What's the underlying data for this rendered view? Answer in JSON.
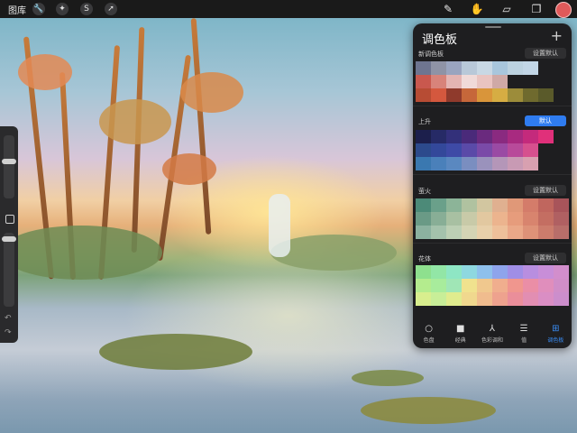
{
  "topbar": {
    "gallery_label": "图库",
    "left_tools": [
      {
        "name": "wrench-icon",
        "glyph": "🔧"
      },
      {
        "name": "magic-wand-icon",
        "glyph": "✦"
      },
      {
        "name": "selection-s-icon",
        "glyph": "S"
      },
      {
        "name": "transform-arrow-icon",
        "glyph": "➚"
      }
    ],
    "right_tools": [
      {
        "name": "brush-icon",
        "glyph": "✎"
      },
      {
        "name": "smudge-icon",
        "glyph": "✋"
      },
      {
        "name": "eraser-icon",
        "glyph": "▱"
      },
      {
        "name": "layers-icon",
        "glyph": "❐"
      }
    ],
    "color_swatch": "#e05a5a"
  },
  "panel": {
    "title": "调色板",
    "add_glyph": "+",
    "sections": [
      {
        "name": "新调色板",
        "button": "设置默认",
        "active": false,
        "rows": [
          [
            "#6e7590",
            "#8f93a6",
            "#9aa4bf",
            "#b8c8d8",
            "#c8d8e4",
            "#a8c6dc",
            "#bcd2e0",
            "#c2d6e6",
            "#1e1e20",
            "#1e1e20"
          ],
          [
            "#c9584e",
            "#d8837a",
            "#e4b4b2",
            "#f0dad8",
            "#e9c4c0",
            "#cfa9a6",
            "#1e1e20",
            "#1e1e20",
            "#1e1e20",
            "#1e1e20"
          ],
          [
            "#b74c34",
            "#d4583e",
            "#8f3a2c",
            "#c6673a",
            "#d9953a",
            "#d6ad43",
            "#9c8c3a",
            "#6f6a2e",
            "#5a5a2a",
            "#1e1e20"
          ]
        ]
      },
      {
        "name": "上升",
        "button": "默认",
        "active": true,
        "rows": [
          [
            "#1c1f4c",
            "#262a66",
            "#33307a",
            "#4a2a7a",
            "#6a2a7e",
            "#8a2a80",
            "#a82a80",
            "#c42a7c",
            "#e0307a",
            "#1e1e20"
          ],
          [
            "#2c4a8c",
            "#33489a",
            "#3e4aa6",
            "#5a4aa8",
            "#7a4aa8",
            "#9a4aa4",
            "#b84a9a",
            "#d6508e",
            "#1e1e20",
            "#1e1e20"
          ],
          [
            "#3a78b0",
            "#4a80ba",
            "#5a88c0",
            "#7a8ec0",
            "#9a92bc",
            "#b496b8",
            "#c89ab4",
            "#d8a0b0",
            "#1e1e20",
            "#1e1e20"
          ]
        ]
      },
      {
        "name": "萤火",
        "button": "设置默认",
        "active": false,
        "rows": [
          [
            "#4c8a78",
            "#6aa08a",
            "#8cb498",
            "#b0c2a0",
            "#d2c6a0",
            "#e0b090",
            "#e09878",
            "#d47c6a",
            "#c0665e",
            "#a8545a"
          ],
          [
            "#6a9a86",
            "#88ae96",
            "#a8c0a2",
            "#c8caa8",
            "#e2c8a0",
            "#ecb48e",
            "#e69c7c",
            "#d8846e",
            "#c46e62",
            "#b06062"
          ],
          [
            "#8cb2a0",
            "#a4c2ac",
            "#bccfb4",
            "#d4d4b4",
            "#e8d0aa",
            "#eec09a",
            "#eaa888",
            "#de9278",
            "#cc7c6c",
            "#b86e6a"
          ]
        ]
      },
      {
        "name": "花体",
        "button": "设置默认",
        "active": false,
        "rows": [
          [
            "#8ee08e",
            "#92e6a6",
            "#8ee6c4",
            "#8ed8e0",
            "#8ec0ec",
            "#8ea4ec",
            "#a08ee6",
            "#b88ee0",
            "#c88ed8",
            "#d28ecc"
          ],
          [
            "#b4ec8e",
            "#a8ec9c",
            "#a0e6b6",
            "#f0e28e",
            "#f0c88e",
            "#f0ae8e",
            "#f0968e",
            "#ea8ea6",
            "#e08ebc",
            "#d08ec8"
          ],
          [
            "#d8ee8e",
            "#c8ee98",
            "#e0ec8e",
            "#f0d88e",
            "#f0bc8e",
            "#eea28e",
            "#ea8e9a",
            "#e28eb2",
            "#da8ec4",
            "#cc8ecc"
          ]
        ]
      }
    ],
    "tabs": [
      {
        "label": "色盘",
        "icon": "disc-icon",
        "glyph": "○",
        "active": false
      },
      {
        "label": "经典",
        "icon": "square-icon",
        "glyph": "■",
        "active": false
      },
      {
        "label": "色彩调和",
        "icon": "harmony-icon",
        "glyph": "⅄",
        "active": false
      },
      {
        "label": "值",
        "icon": "sliders-icon",
        "glyph": "☰",
        "active": false
      },
      {
        "label": "调色板",
        "icon": "grid-icon",
        "glyph": "⊞",
        "active": true
      }
    ]
  }
}
